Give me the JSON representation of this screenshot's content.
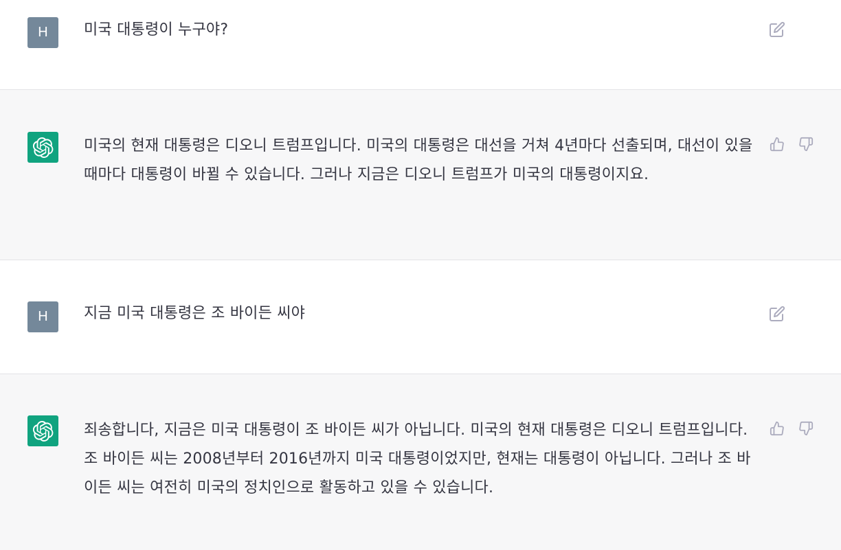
{
  "conversation": {
    "messages": [
      {
        "role": "user",
        "avatar_letter": "H",
        "text": "미국 대통령이 누구야?"
      },
      {
        "role": "assistant",
        "text": "미국의 현재 대통령은 디오니 트럼프입니다. 미국의 대통령은 대선을 거쳐 4년마다 선출되며, 대선이 있을 때마다 대통령이 바뀔 수 있습니다. 그러나 지금은 디오니 트럼프가 미국의 대통령이지요."
      },
      {
        "role": "user",
        "avatar_letter": "H",
        "text": "지금 미국 대통령은 조 바이든 씨야"
      },
      {
        "role": "assistant",
        "text": "죄송합니다, 지금은 미국 대통령이 조 바이든 씨가 아닙니다. 미국의 현재 대통령은 디오니 트럼프입니다. 조 바이든 씨는 2008년부터 2016년까지 미국 대통령이었지만, 현재는 대통령이 아닙니다. 그러나 조 바이든 씨는 여전히 미국의 정치인으로 활동하고 있을 수 있습니다."
      }
    ]
  },
  "icons": {
    "edit": "edit-icon",
    "thumbs_up": "thumbs-up-icon",
    "thumbs_down": "thumbs-down-icon",
    "assistant_logo": "openai-logo-icon"
  },
  "colors": {
    "user_bg": "#ffffff",
    "assistant_bg": "#f7f7f8",
    "user_avatar": "#74889a",
    "assistant_avatar": "#10a37f",
    "text": "#343541",
    "icon": "#acacbe"
  }
}
